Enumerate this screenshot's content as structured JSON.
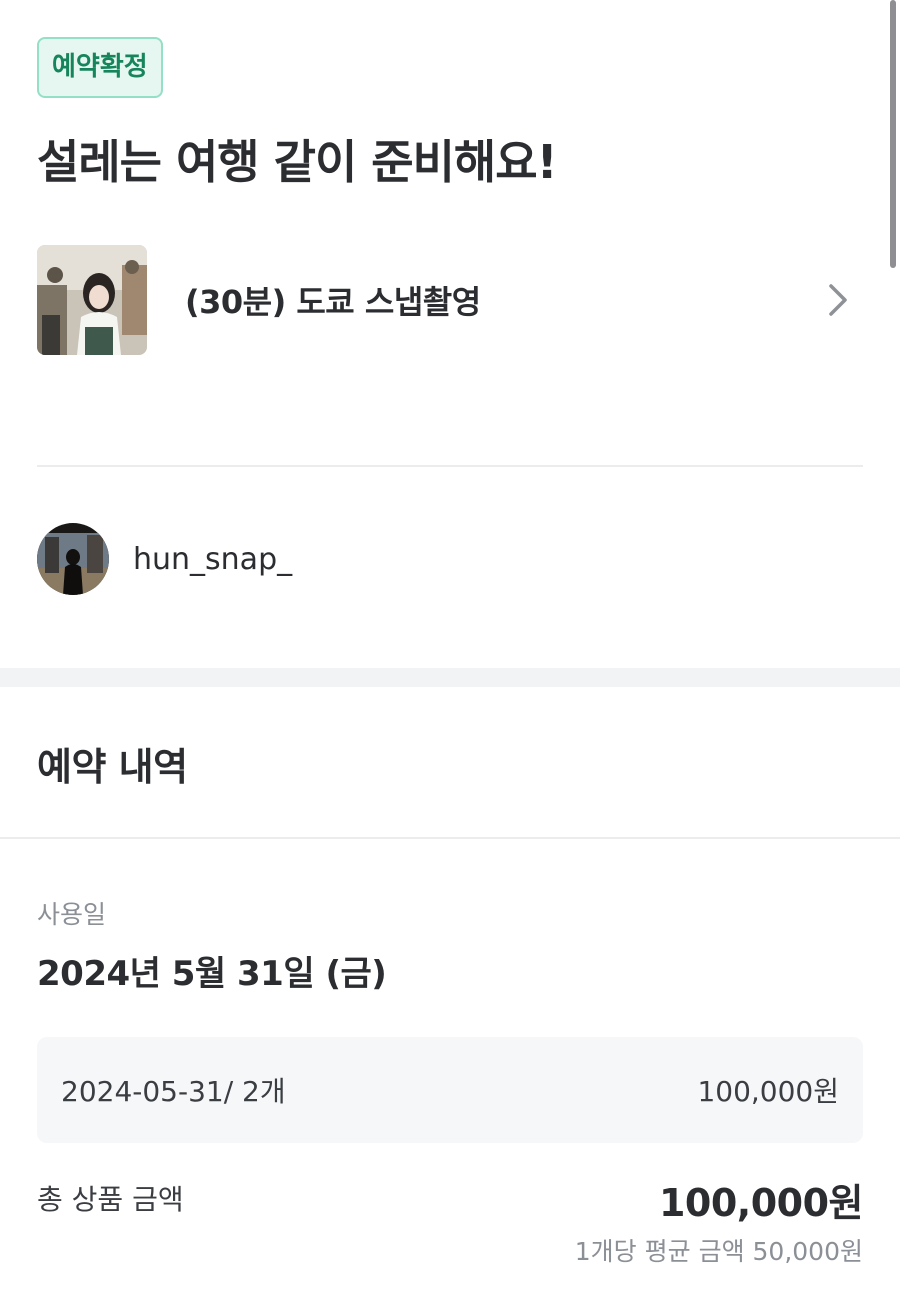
{
  "status_badge": "예약확정",
  "headline": "설레는 여행 같이 준비해요!",
  "product": {
    "title": "(30분) 도쿄 스냅촬영",
    "thumbnail_icon": "photo-thumbnail",
    "chevron_icon": "chevron-right-icon"
  },
  "host": {
    "name": "hun_snap_",
    "avatar_icon": "avatar"
  },
  "reservation": {
    "section_title": "예약 내역",
    "use_date_label": "사용일",
    "use_date": "2024년 5월 31일 (금)",
    "line_item": {
      "detail": "2024-05-31/ 2개",
      "price": "100,000원"
    },
    "total_label": "총 상품 금액",
    "total_amount": "100,000원",
    "average_note": "1개당 평균 금액 50,000원"
  },
  "colors": {
    "badge_text": "#17855c",
    "badge_bg": "#e6f7f1",
    "badge_border": "#94e0c4",
    "text_primary": "#2b2d31",
    "text_secondary": "#8b8f96"
  }
}
